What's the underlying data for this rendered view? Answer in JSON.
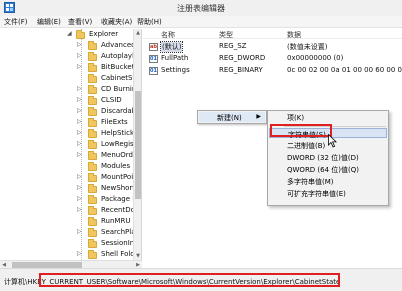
{
  "window": {
    "title": "注册表编辑器"
  },
  "menubar": [
    "文件(F)",
    "编辑(E)",
    "查看(V)",
    "收藏夹(A)",
    "帮助(H)"
  ],
  "tree": {
    "items": [
      {
        "label": "Explorer",
        "expanded": true
      },
      {
        "label": "Advanced"
      },
      {
        "label": "Autoplayh"
      },
      {
        "label": "BitBucket"
      },
      {
        "label": "CabinetSta"
      },
      {
        "label": "CD Burnin"
      },
      {
        "label": "CLSID"
      },
      {
        "label": "Discardab"
      },
      {
        "label": "FileExts"
      },
      {
        "label": "HelpSticke"
      },
      {
        "label": "LowRegist"
      },
      {
        "label": "MenuOrde"
      },
      {
        "label": "Modules"
      },
      {
        "label": "MountPoin"
      },
      {
        "label": "NewShort"
      },
      {
        "label": "Package I"
      },
      {
        "label": "RecentDoc"
      },
      {
        "label": "RunMRU"
      },
      {
        "label": "SearchPlat"
      },
      {
        "label": "SessionInf"
      },
      {
        "label": "Shell Fold"
      }
    ]
  },
  "list": {
    "headers": [
      "名称",
      "类型",
      "数据"
    ],
    "rows": [
      {
        "icon": "string-value-icon",
        "name": "(默认)",
        "type": "REG_SZ",
        "data": "(数值未设置)"
      },
      {
        "icon": "binary-value-icon",
        "name": "FullPath",
        "type": "REG_DWORD",
        "data": "0x00000000 (0)"
      },
      {
        "icon": "binary-value-icon",
        "name": "Settings",
        "type": "REG_BINARY",
        "data": "0c 00 02 00 0a 01 00 00 60 00 00 00"
      }
    ]
  },
  "context_menu": {
    "new_label": "新建(N)",
    "submenu": [
      {
        "label": "项(K)"
      },
      {
        "label": "字符串值(S)",
        "highlighted": true
      },
      {
        "label": "二进制值(B)"
      },
      {
        "label": "DWORD (32 位)值(D)"
      },
      {
        "label": "QWORD (64 位)值(Q)"
      },
      {
        "label": "多字符串值(M)"
      },
      {
        "label": "可扩充字符串值(E)"
      }
    ]
  },
  "statusbar": {
    "path": "计算机\\HKEY_CURRENT_USER\\Software\\Microsoft\\Windows\\CurrentVersion\\Explorer\\CabinetState"
  },
  "colors": {
    "highlight_box": "#e02020",
    "folder": "#f0c75e"
  }
}
